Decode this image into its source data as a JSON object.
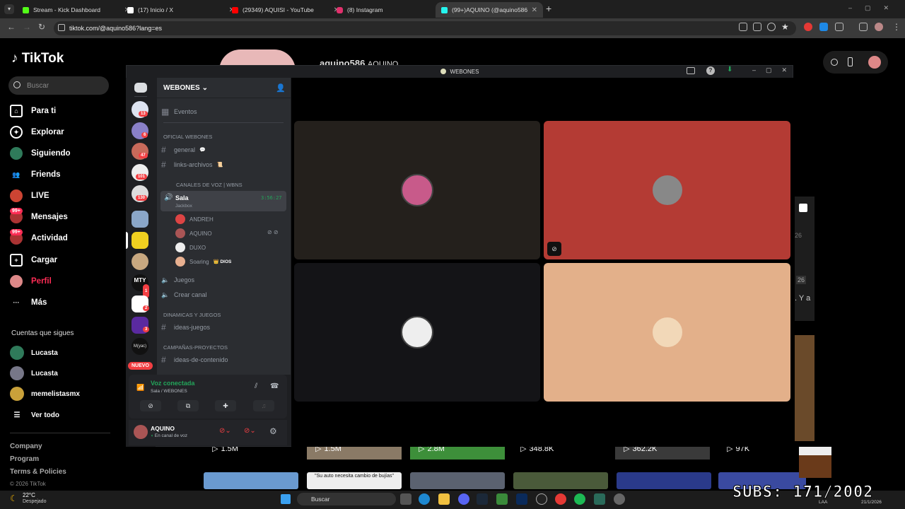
{
  "browser": {
    "tabs": [
      {
        "title": "Stream - Kick Dashboard",
        "color": "#53fc18"
      },
      {
        "title": "(17) Inicio / X",
        "color": "#ffffff"
      },
      {
        "title": "(29349) AQUISI - YouTube",
        "color": "#ff0000"
      },
      {
        "title": "(8) Instagram",
        "color": "#e1306c"
      },
      {
        "title": "(99+)AQUINO (@aquino586) |",
        "color": "#25f4ee"
      }
    ],
    "new_tab": "+",
    "url": "tiktok.com/@aquino586?lang=es"
  },
  "tiktok": {
    "logo": "TikTok",
    "search_placeholder": "Buscar",
    "nav": [
      {
        "label": "Para ti",
        "icon": "home-icon"
      },
      {
        "label": "Explorar",
        "icon": "compass-icon"
      },
      {
        "label": "Siguiendo",
        "icon": "following-icon"
      },
      {
        "label": "Friends",
        "icon": "friends-icon"
      },
      {
        "label": "LIVE",
        "icon": "live-icon"
      },
      {
        "label": "Mensajes",
        "icon": "messages-icon",
        "badge": "99+"
      },
      {
        "label": "Actividad",
        "icon": "activity-icon",
        "badge": "99+"
      },
      {
        "label": "Cargar",
        "icon": "upload-icon"
      },
      {
        "label": "Perfil",
        "icon": "profile-icon"
      },
      {
        "label": "Más",
        "icon": "more-icon"
      }
    ],
    "following_title": "Cuentas que sigues",
    "following": [
      "Lucasta",
      "Lucasta",
      "memelistasmx"
    ],
    "see_all": "Ver todo",
    "footer": [
      "Company",
      "Program",
      "Terms & Policies"
    ],
    "copyright": "© 2026 TikTok",
    "profile_name_partial": "aquino586",
    "profile_nick_partial": "AQUINO",
    "video_stats": [
      "1.5M",
      "1.5M",
      "2.8M",
      "348.8K",
      "362.2K",
      "97K"
    ],
    "thumb_caption": "\"Su auto necesita cambio de bujías\"",
    "side_snippets": [
      "26",
      "26",
      ". Y a"
    ]
  },
  "discord": {
    "window_title": "WEBONES",
    "server_name": "WEBONES",
    "server_badges": [
      "13",
      "6",
      "47",
      "101",
      "130",
      "1",
      "2",
      "3",
      "1"
    ],
    "new_badge": "NUEVO",
    "events": "Eventos",
    "categories": {
      "oficial": "OFICIAL WEBONES",
      "voz": "CANALES DE VOZ | WBNS",
      "dinamicas": "DINAMICAS Y JUEGOS",
      "campanas": "CAMPAÑAS-PROYECTOS"
    },
    "text_channels": {
      "general": "general",
      "links": "links-archivos",
      "ideas_juegos": "ideas-juegos",
      "ideas_contenido": "ideas-de-contenido"
    },
    "voice_channel": {
      "name": "Sala",
      "sub": "Jackbox",
      "timer": "3:56:27"
    },
    "voice_users": [
      "ANDREH",
      "AQUINO",
      "DUXO",
      "Soaring"
    ],
    "soaring_tag": "DIOS",
    "other_voice": {
      "juegos": "Juegos",
      "crear": "Crear canal"
    },
    "voice_status": {
      "title": "Voz conectada",
      "sub": "Sala / WEBONES"
    },
    "user": {
      "name": "AQUINO",
      "status": "En canal de voz"
    },
    "tiles": [
      {
        "color": "#24201c"
      },
      {
        "color": "#b43b34"
      },
      {
        "color": "#141417"
      },
      {
        "color": "#e3b08a"
      }
    ]
  },
  "taskbar": {
    "weather_temp": "22°C",
    "weather_desc": "Despejado",
    "search": "Buscar",
    "lang": "LAA",
    "date": "21/1/2026"
  },
  "overlay": {
    "subs": "SUBS: 171/2002"
  }
}
